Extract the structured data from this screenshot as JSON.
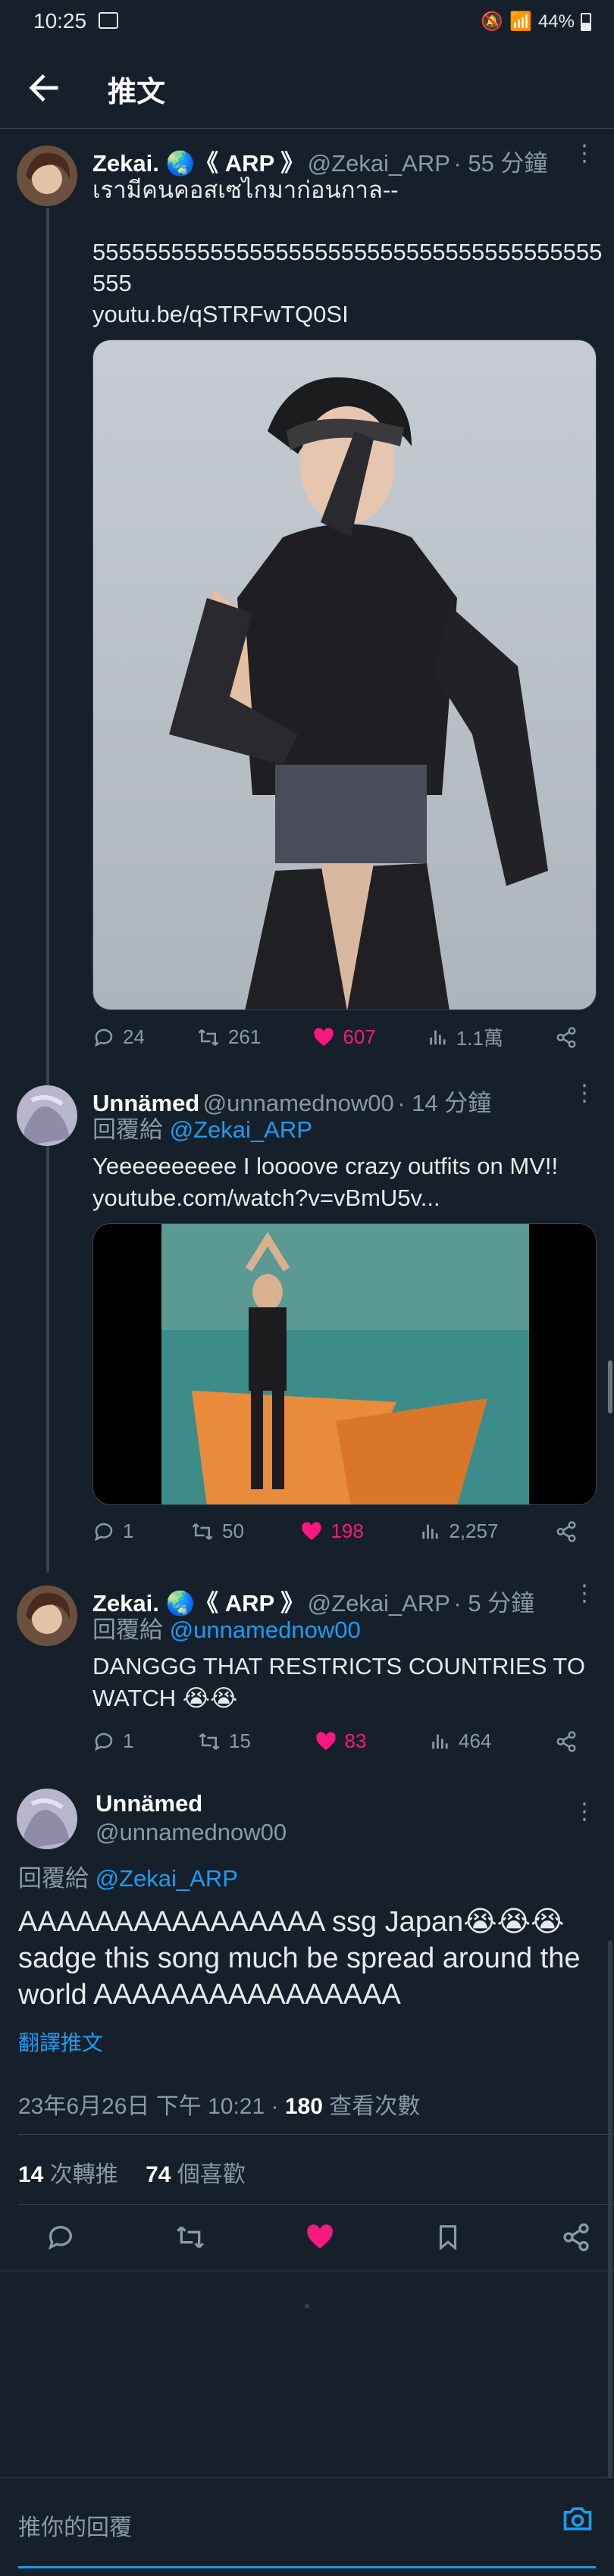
{
  "status_bar": {
    "time": "10:25",
    "battery": "44%"
  },
  "header": {
    "title": "推文"
  },
  "tweets": [
    {
      "name": "Zekai. 🌏《 ARP 》",
      "handle": "@Zekai_ARP",
      "time": "· 55 分鐘",
      "text_line1": "เรามีคนคอสเซไกมาก่อนกาล--",
      "text_line2": "555555555555555555555555555555555555555",
      "text_line3": "555",
      "link": "youtu.be/qSTRFwTQ0SI",
      "replies": "24",
      "retweets": "261",
      "likes": "607",
      "views": "1.1萬"
    },
    {
      "name": "Unnämed",
      "handle": "@unnamednow00",
      "time": "· 14 分鐘",
      "reply_label": "回覆給",
      "reply_to": "@Zekai_ARP",
      "text": "Yeeeeeeeeee I loooove crazy outfits on MV!!",
      "link": "youtube.com/watch?v=vBmU5v...",
      "replies": "1",
      "retweets": "50",
      "likes": "198",
      "views": "2,257"
    },
    {
      "name": "Zekai. 🌏《 ARP 》",
      "handle": "@Zekai_ARP",
      "time": "· 5 分鐘",
      "reply_label": "回覆給",
      "reply_to": "@unnamednow00",
      "text_line1": "DANGGG THAT RESTRICTS COUNTRIES TO",
      "text_line2": "WATCH 😭😭",
      "replies": "1",
      "retweets": "15",
      "likes": "83",
      "views": "464"
    }
  ],
  "main_tweet": {
    "name": "Unnämed",
    "handle": "@unnamednow00",
    "reply_label": "回覆給",
    "reply_to": "@Zekai_ARP",
    "text_line1": "AAAAAAAAAAAAAAAA ssg Japan😭😭😭",
    "text_line2": "sadge this song much be spread around the",
    "text_line3": "world AAAAAAAAAAAAAAAA",
    "translate": "翻譯推文",
    "timestamp": "23年6月26日 下午 10:21 · ",
    "view_count": "180",
    "view_label": " 查看次數",
    "retweet_count": "14",
    "retweet_label": " 次轉推",
    "like_count": "74",
    "like_label": " 個喜歡"
  },
  "reply_bar": {
    "placeholder": "推你的回覆"
  },
  "colors": {
    "background": "#15202b",
    "accent": "#1d9bf0",
    "like": "#f91880",
    "muted": "#8b98a5"
  }
}
